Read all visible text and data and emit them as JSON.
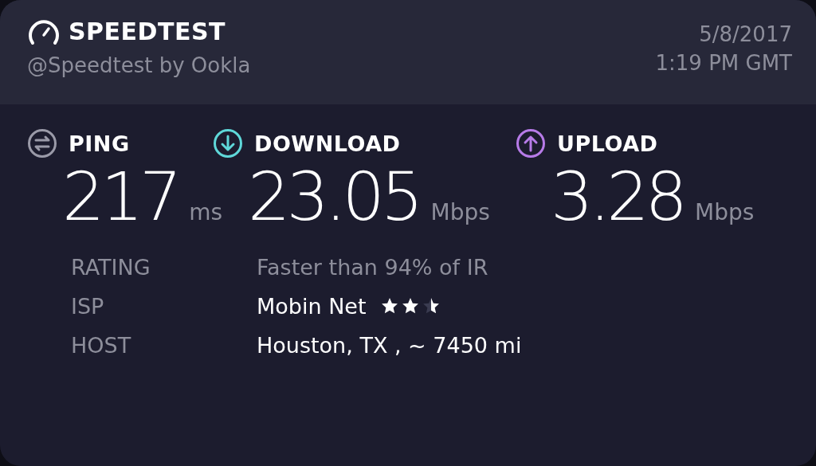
{
  "header": {
    "brand": "SPEEDTEST",
    "byline": "@Speedtest by Ookla",
    "date": "5/8/2017",
    "time": "1:19 PM GMT"
  },
  "metrics": [
    {
      "kind": "ping",
      "label": "PING",
      "value": "217",
      "unit": "ms",
      "color": "#9a9aa8"
    },
    {
      "kind": "download",
      "label": "DOWNLOAD",
      "value": "23.05",
      "unit": "Mbps",
      "color": "#5fd8d9"
    },
    {
      "kind": "upload",
      "label": "UPLOAD",
      "value": "3.28",
      "unit": "Mbps",
      "color": "#b77be8"
    }
  ],
  "details": [
    {
      "label": "RATING",
      "value": "Faster than 94% of IR"
    },
    {
      "label": "ISP",
      "value": "Mobin Net",
      "stars": 2.5
    },
    {
      "label": "HOST",
      "value": "Houston, TX , ~ 7450 mi"
    }
  ]
}
